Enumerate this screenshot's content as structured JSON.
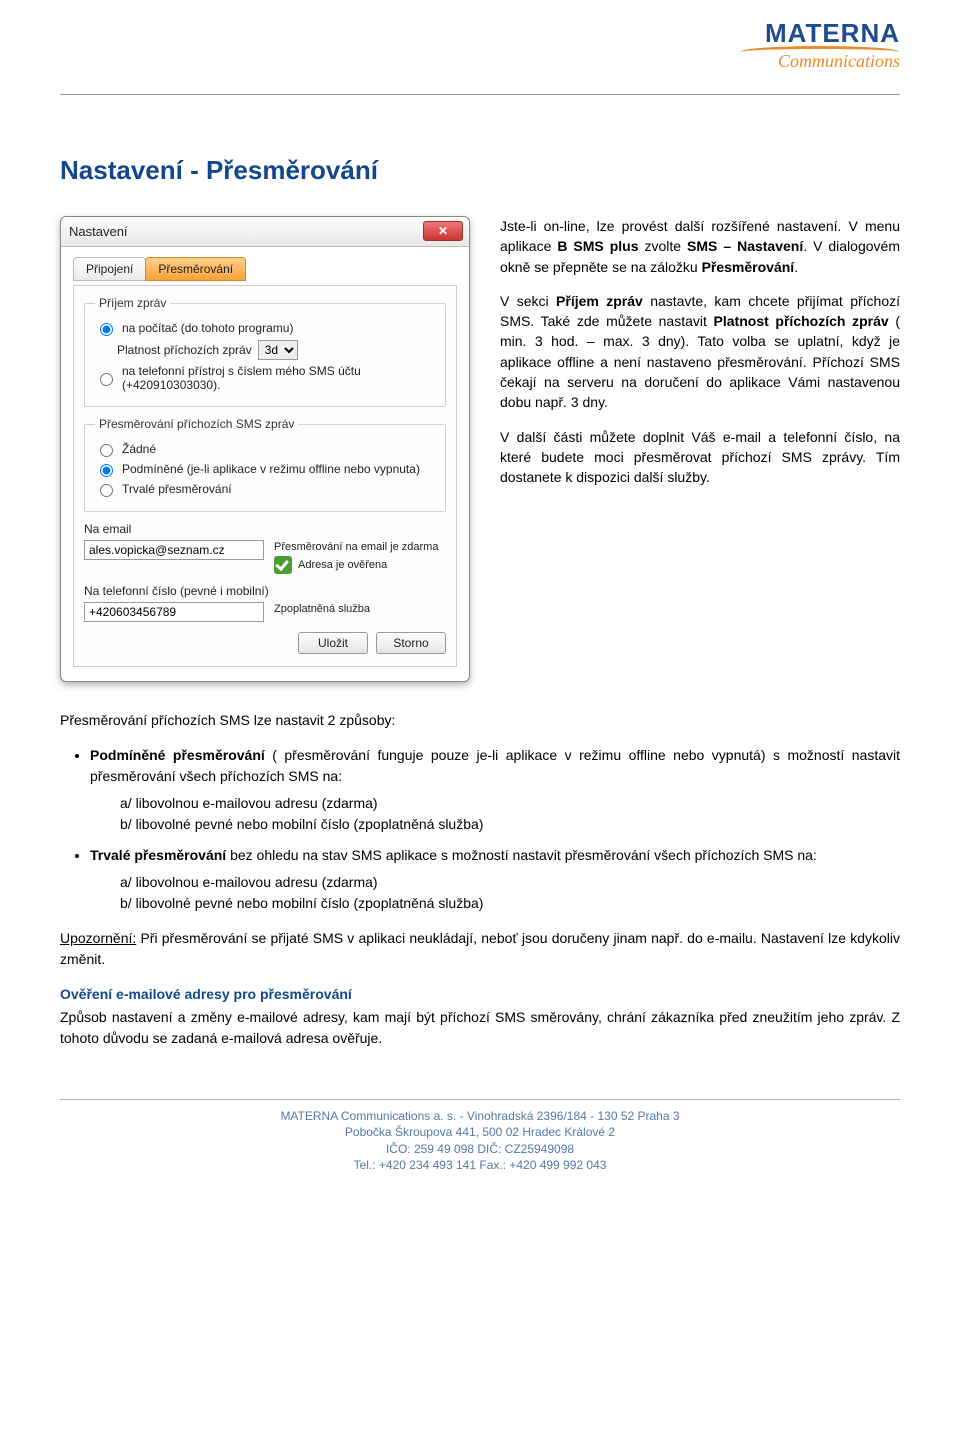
{
  "logo": {
    "top": "MATERNA",
    "sub": "Communications"
  },
  "title": "Nastavení - Přesměrování",
  "intro": {
    "p1_a": "Jste-li on-line, lze provést další rozšířené nastavení. V menu aplikace ",
    "p1_b": "B SMS plus",
    "p1_c": " zvolte ",
    "p1_d": "SMS – Nastavení",
    "p1_e": ". V dialogovém okně se přepněte se na záložku ",
    "p1_f": "Přesměrování",
    "p1_g": ".",
    "p2_a": "V sekci ",
    "p2_b": "Příjem zpráv",
    "p2_c": " nastavte, kam chcete přijímat příchozí SMS. Také zde můžete nastavit ",
    "p2_d": "Platnost příchozích zpráv",
    "p2_e": " ( min. 3 hod. – max. 3 dny). Tato volba se uplatní, když je aplikace offline a není nastaveno přesměrování. Příchozí SMS čekají na serveru na doručení do aplikace Vámi nastavenou dobu např. 3 dny.",
    "p3": "V další části můžete doplnit Váš e-mail a telefonní číslo, na které budete moci přesměrovat příchozí SMS zprávy. Tím dostanete k dispozici další služby."
  },
  "dialog": {
    "title": "Nastavení",
    "tabs": {
      "t1": "Připojení",
      "t2": "Přesměrování"
    },
    "group1": {
      "legend": "Příjem zpráv",
      "r1": "na počítač (do tohoto programu)",
      "validity_label": "Platnost příchozích zpráv",
      "validity_value": "3d",
      "r2": "na telefonní přístroj s číslem mého SMS účtu (+420910303030)."
    },
    "group2": {
      "legend": "Přesměrování příchozích SMS zpráv",
      "r_none": "Žádné",
      "r_cond": "Podmíněné (je-li aplikace v režimu offline nebo vypnuta)",
      "r_perm": "Trvalé přesměrování"
    },
    "email_label": "Na email",
    "email_value": "ales.vopicka@seznam.cz",
    "email_note": "Přesměrování na email je zdarma",
    "verified": "Adresa je ověřena",
    "phone_label": "Na telefonní číslo (pevné i mobilní)",
    "phone_value": "+420603456789",
    "phone_note": "Zpoplatněná služba",
    "btn_save": "Uložit",
    "btn_cancel": "Storno"
  },
  "body": {
    "lead": "Přesměrování příchozích SMS lze nastavit 2 způsoby:",
    "li1_a": "Podmíněné přesměrování",
    "li1_b": " ( přesměrování funguje pouze je-li aplikace v režimu offline nebo vypnutá) s možností nastavit přesměrování všech příchozích SMS na:",
    "sub_a": "a/ libovolnou e-mailovou adresu (zdarma)",
    "sub_b": "b/ libovolné pevné nebo mobilní číslo (zpoplatněná služba)",
    "li2_a": "Trvalé přesměrování",
    "li2_b": " bez ohledu na stav SMS aplikace s možností nastavit přesměrování všech příchozích SMS na:",
    "warn_a": "Upozornění:",
    "warn_b": " Při přesměrování se přijaté SMS v aplikaci neukládají, neboť jsou doručeny jinam např. do e-mailu. Nastavení lze kdykoliv změnit.",
    "verify_h": "Ověření e-mailové adresy pro přesměrování",
    "verify_p": "Způsob nastavení a změny e-mailové adresy, kam mají být příchozí SMS směrovány, chrání zákazníka před zneužitím jeho zpráv. Z tohoto důvodu se zadaná e-mailová adresa ověřuje."
  },
  "footer": {
    "l1": "MATERNA Communications a. s. - Vinohradská 2396/184 - 130 52  Praha 3",
    "l2": "Pobočka Škroupova 441, 500 02  Hradec Králové 2",
    "l3": "IČO: 259 49 098    DIČ: CZ25949098",
    "l4": "Tel.: +420 234 493 141   Fax.: +420 499 992 043"
  }
}
